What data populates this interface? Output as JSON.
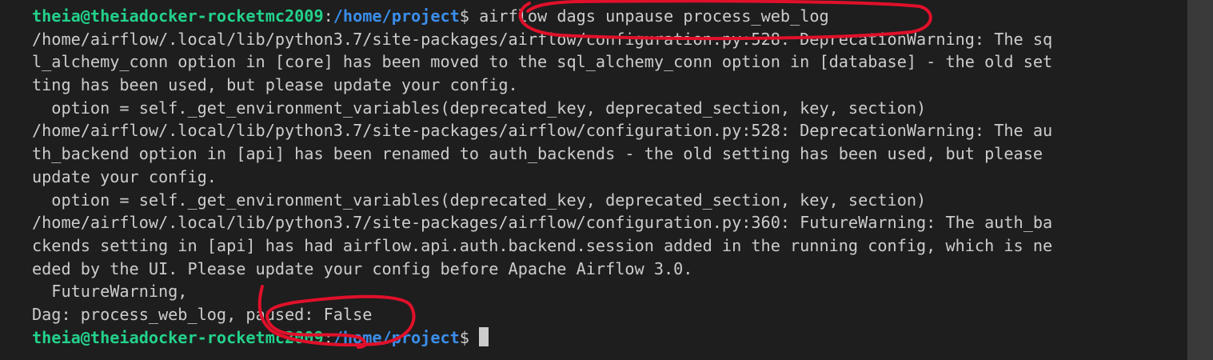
{
  "terminal": {
    "prompt_user": "theia@theiadocker-rocketmc2009",
    "prompt_path": "/home/project",
    "prompt_symbol": "$",
    "command": "airflow dags unpause process_web_log",
    "output_lines": [
      "/home/airflow/.local/lib/python3.7/site-packages/airflow/configuration.py:528: DeprecationWarning: The sq",
      "l_alchemy_conn option in [core] has been moved to the sql_alchemy_conn option in [database] - the old set",
      "ting has been used, but please update your config.",
      "  option = self._get_environment_variables(deprecated_key, deprecated_section, key, section)",
      "/home/airflow/.local/lib/python3.7/site-packages/airflow/configuration.py:528: DeprecationWarning: The au",
      "th_backend option in [api] has been renamed to auth_backends - the old setting has been used, but please",
      "update your config.",
      "  option = self._get_environment_variables(deprecated_key, deprecated_section, key, section)",
      "/home/airflow/.local/lib/python3.7/site-packages/airflow/configuration.py:360: FutureWarning: The auth_ba",
      "ckends setting in [api] has had airflow.api.auth.backend.session added in the running config, which is ne",
      "eded by the UI. Please update your config before Apache Airflow 3.0.",
      "  FutureWarning,",
      "Dag: process_web_log, paused: False"
    ]
  },
  "colors": {
    "background": "#1e1e1e",
    "text": "#cccccc",
    "prompt_user": "#23d18b",
    "prompt_path": "#3b8eea",
    "annotation": "#e0102a"
  }
}
